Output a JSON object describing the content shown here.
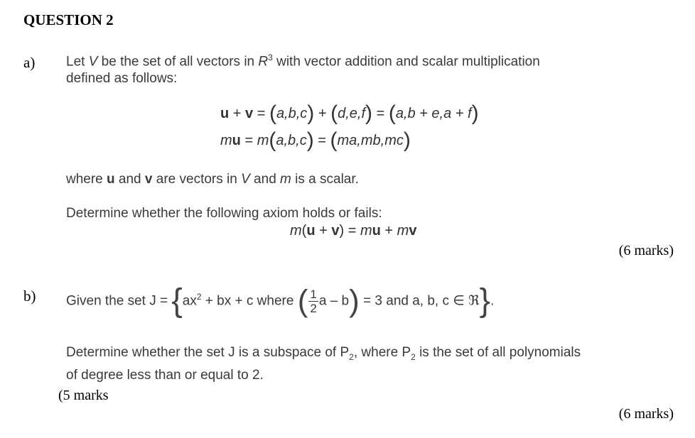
{
  "title": "QUESTION 2",
  "part_a": {
    "label": "a)",
    "intro_line1": {
      "pre": "Let ",
      "V": "V",
      "mid": " be  the set  of  all  vectors  in  ",
      "R": "R",
      "R_exp": "3",
      "post": "  with  vector addition and scalar multiplication"
    },
    "intro_line2": "defined as follows:",
    "eq1": {
      "u": "u",
      "plus": " + ",
      "v": "v",
      "eq": " = ",
      "t1": "a,b,c",
      "t2": "d,e,f",
      "t3": "a,b + e,a + f"
    },
    "eq2": {
      "m": "m",
      "u": "u",
      "eq": " = ",
      "t1": "a,b,c",
      "t2": "ma,mb,mc"
    },
    "where_line": {
      "pre": "where  ",
      "u": "u",
      "and1": " and ",
      "v": "v",
      "mid": " are vectors in ",
      "V": "V",
      "and2": " and ",
      "m": "m",
      "post": " is a scalar."
    },
    "determine": "Determine whether the following axiom holds or fails:",
    "axiom": {
      "m": "m",
      "u": "u",
      "plus": " + ",
      "v": "v",
      "eq": " = ",
      "rhs_m1": "m",
      "rhs_u": "u",
      "rhs_plus": " + ",
      "rhs_m2": "m",
      "rhs_v": "v"
    },
    "marks": "(6 marks)"
  },
  "part_b": {
    "label": "b)",
    "given": "Given the set ",
    "J": "J = ",
    "poly_a": "ax",
    "poly_exp": "2",
    "poly_rest": " + bx + c where ",
    "frac_num": "1",
    "frac_den": "2",
    "cond": "a – b",
    "eq3": " = 3   and  a, b, c ∈ ℜ",
    "period": ".",
    "determine1_pre": "Determine whether the set J is a subspace of P",
    "sub1": "2",
    "determine1_mid": ", where P",
    "sub2": "2",
    "determine1_post": " is the set of all polynomials",
    "determine2": "of degree less than or equal to 2.",
    "stray_marks": "(5 marks",
    "marks": "(6 marks)"
  }
}
